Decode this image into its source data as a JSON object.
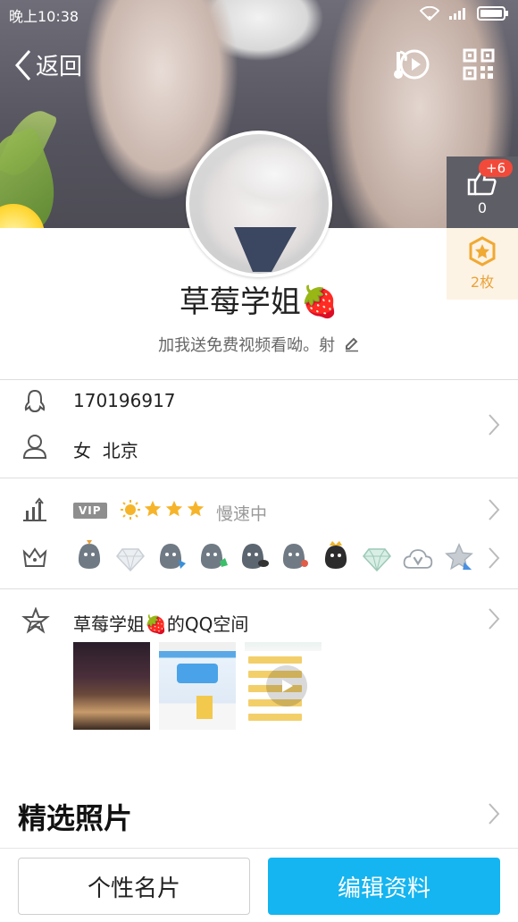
{
  "status_bar": {
    "time": "晚上10:38"
  },
  "nav": {
    "back_label": "返回"
  },
  "like": {
    "count": "0",
    "badge": "+6"
  },
  "medal": {
    "label": "2枚"
  },
  "profile": {
    "nickname": "草莓学姐🍓",
    "signature": "加我送免费视频看呦。射"
  },
  "info": {
    "qq_number": "170196917",
    "gender_location": "女  北京"
  },
  "vip": {
    "tag": "VIP",
    "status": "慢速中"
  },
  "qzone": {
    "title": "草莓学姐🍓的QQ空间"
  },
  "sections": {
    "featured_photos": "精选照片"
  },
  "bottom": {
    "card_button": "个性名片",
    "edit_button": "编辑资料"
  },
  "colors": {
    "accent": "#14b5f0",
    "badge_red": "#f24a3a",
    "medal_gold": "#e9a33a"
  }
}
